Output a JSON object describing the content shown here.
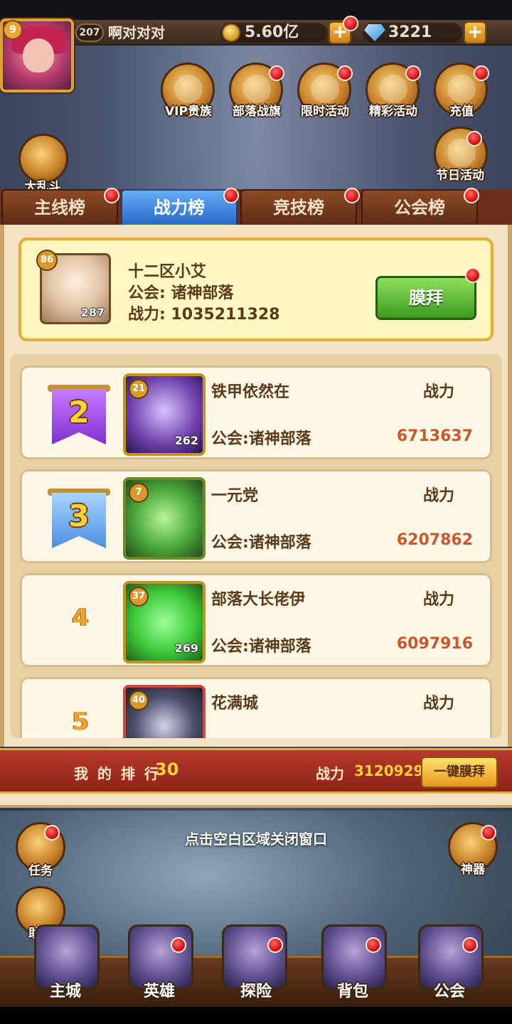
{
  "hud": {
    "avatar_level": "9",
    "player_level": "207",
    "player_name": "啊对对对",
    "gold": "5.60亿",
    "gems": "3221",
    "plus": "+"
  },
  "menu": [
    {
      "label": "VIP贵族",
      "icon": "crown-icon"
    },
    {
      "label": "部落战旗",
      "icon": "banner-icon"
    },
    {
      "label": "限时活动",
      "icon": "clock-icon"
    },
    {
      "label": "精彩活动",
      "icon": "star-icon"
    },
    {
      "label": "充值",
      "icon": "diamond-icon"
    },
    {
      "label": "节日活动",
      "icon": "gift-chest-icon"
    }
  ],
  "side_left_top": {
    "label": "大乱斗"
  },
  "tabs": [
    {
      "label": "主线榜",
      "active": false
    },
    {
      "label": "战力榜",
      "active": true
    },
    {
      "label": "竞技榜",
      "active": false
    },
    {
      "label": "公会榜",
      "active": false
    }
  ],
  "top_player": {
    "level": "86",
    "stars": "287",
    "name": "十二区小艾",
    "guild": "公会: 诸神部落",
    "power": "战力: 1035211328",
    "worship_label": "膜拜"
  },
  "rows": [
    {
      "rank": "2",
      "level": "21",
      "stars": "262",
      "name": "铁甲依然在",
      "guild": "公会:诸神部落",
      "power_label": "战力",
      "power": "6713637"
    },
    {
      "rank": "3",
      "level": "7",
      "stars": "",
      "name": "一元党",
      "guild": "公会:诸神部落",
      "power_label": "战力",
      "power": "6207862"
    },
    {
      "rank": "4",
      "level": "37",
      "stars": "269",
      "name": "部落大长佬伊",
      "guild": "公会:诸神部落",
      "power_label": "战力",
      "power": "6097916"
    },
    {
      "rank": "5",
      "level": "40",
      "stars": "",
      "name": "花满城",
      "guild": "",
      "power_label": "战力",
      "power": ""
    }
  ],
  "my_rank": {
    "label": "我 的 排 行",
    "value": "30",
    "power_label": "战力",
    "power": "3120929",
    "button": "一键膜拜"
  },
  "close_hint": "点击空白区域关闭窗口",
  "side_left": [
    {
      "label": "任务"
    },
    {
      "label": "助手"
    }
  ],
  "side_right": [
    {
      "label": "神器"
    }
  ],
  "nav": [
    {
      "label": "主城"
    },
    {
      "label": "英雄"
    },
    {
      "label": "探险"
    },
    {
      "label": "背包"
    },
    {
      "label": "公会"
    }
  ]
}
